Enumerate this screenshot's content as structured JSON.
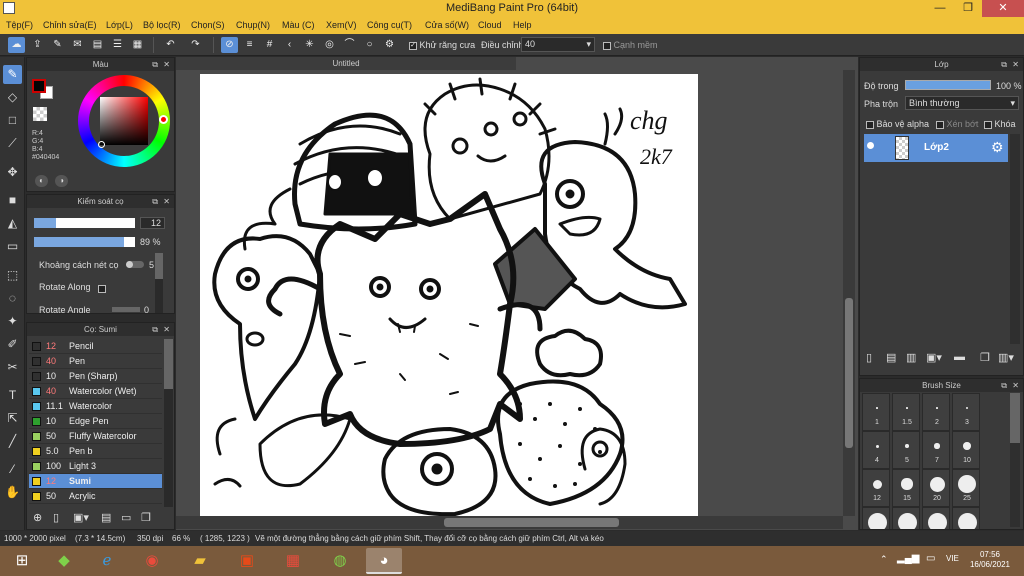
{
  "window": {
    "title": "MediBang Paint Pro (64bit)",
    "minimize": "—",
    "maximize": "❐",
    "close": "✕"
  },
  "menu": [
    "Tệp(F)",
    "Chỉnh sửa(E)",
    "Lớp(L)",
    "Bộ lọc(R)",
    "Chọn(S)",
    "Chụp(N)",
    "Màu (C)",
    "Xem(V)",
    "Công cụ(T)",
    "Cửa số(W)",
    "Cloud",
    "Help"
  ],
  "toolbar": {
    "antialias_label": "Khử răng cưa",
    "correction_label": "Điều chỉnh",
    "correction_value": "40",
    "smooth_label": "Cạnh mềm"
  },
  "color_panel": {
    "title": "Màu",
    "r": "R:4",
    "g": "G:4",
    "b": "B:4",
    "hex": "#040404",
    "primary_color": "#040404",
    "secondary_color": "#ffffff"
  },
  "brush_control": {
    "title": "Kiểm soát cọ",
    "size_value": "12",
    "opacity_value": "89 %",
    "opacity_fraction": 0.89,
    "spacing_label": "Khoảng cách nét cọ",
    "spacing_value": "5",
    "rotate_along_label": "Rotate Along",
    "rotate_angle_label": "Rotate Angle",
    "rotate_angle_value": "0"
  },
  "brush_panel": {
    "title": "Cọ: Sumi",
    "brushes": [
      {
        "size": "12",
        "name": "Pencil",
        "color": "#303030",
        "size_color": "#ff7a7a"
      },
      {
        "size": "40",
        "name": "Pen",
        "color": "#303030",
        "size_color": "#ff7a7a"
      },
      {
        "size": "10",
        "name": "Pen (Sharp)",
        "color": "#303030",
        "size_color": "#eeeeee"
      },
      {
        "size": "40",
        "name": "Watercolor (Wet)",
        "color": "#5ac8f0",
        "size_color": "#ff7a7a"
      },
      {
        "size": "11.1",
        "name": "Watercolor",
        "color": "#5ac8f0",
        "size_color": "#eeeeee"
      },
      {
        "size": "10",
        "name": "Edge Pen",
        "color": "#2ea02e",
        "size_color": "#eeeeee"
      },
      {
        "size": "50",
        "name": "Fluffy Watercolor",
        "color": "#9ad060",
        "size_color": "#eeeeee"
      },
      {
        "size": "5.0",
        "name": "Pen b",
        "color": "#f0d020",
        "size_color": "#eeeeee"
      },
      {
        "size": "100",
        "name": "Light 3",
        "color": "#9ad060",
        "size_color": "#eeeeee"
      },
      {
        "size": "12",
        "name": "Sumi",
        "color": "#f0d020",
        "size_color": "#ff7a7a"
      },
      {
        "size": "50",
        "name": "Acrylic",
        "color": "#f0d020",
        "size_color": "#eeeeee"
      }
    ],
    "selected_index": 9
  },
  "canvas": {
    "tab_title": "Untitled",
    "doodle_text_1": "chg",
    "doodle_text_2": "2k7"
  },
  "layer_panel": {
    "title": "Lớp",
    "opacity_label": "Độ trong",
    "opacity_value": "100 %",
    "blend_label": "Pha trộn",
    "blend_value": "Bình thường",
    "protect_alpha": "Bảo vệ alpha",
    "clipping": "Xén bớt",
    "lock": "Khóa",
    "layer_name": "Lớp2"
  },
  "brush_size_panel": {
    "title": "Brush Size",
    "sizes": [
      {
        "label": "1",
        "size": 1
      },
      {
        "label": "1.5",
        "size": 1.5
      },
      {
        "label": "2",
        "size": 2
      },
      {
        "label": "3",
        "size": 3
      },
      {
        "label": "4",
        "size": 4
      },
      {
        "label": "5",
        "size": 5
      },
      {
        "label": "7",
        "size": 7
      },
      {
        "label": "10",
        "size": 10
      },
      {
        "label": "12",
        "size": 12
      },
      {
        "label": "15",
        "size": 15
      },
      {
        "label": "20",
        "size": 20
      },
      {
        "label": "25",
        "size": 25
      },
      {
        "label": "",
        "size": 30
      },
      {
        "label": "",
        "size": 35
      },
      {
        "label": "",
        "size": 40
      },
      {
        "label": "",
        "size": 50
      }
    ]
  },
  "status": {
    "doc_size": "1000 * 2000 pixel",
    "cm_size": "(7.3 * 14.5cm)",
    "dpi": "350 dpi",
    "zoom": "66 %",
    "cursor": "( 1285, 1223 )",
    "hint": "Vẽ một đường thẳng bằng cách giữ phím Shift, Thay đổi cỡ cọ bằng cách giữ phím Ctrl, Alt và kéo"
  },
  "taskbar": {
    "time": "07:56",
    "date": "16/06/2021",
    "lang": "VIE"
  }
}
